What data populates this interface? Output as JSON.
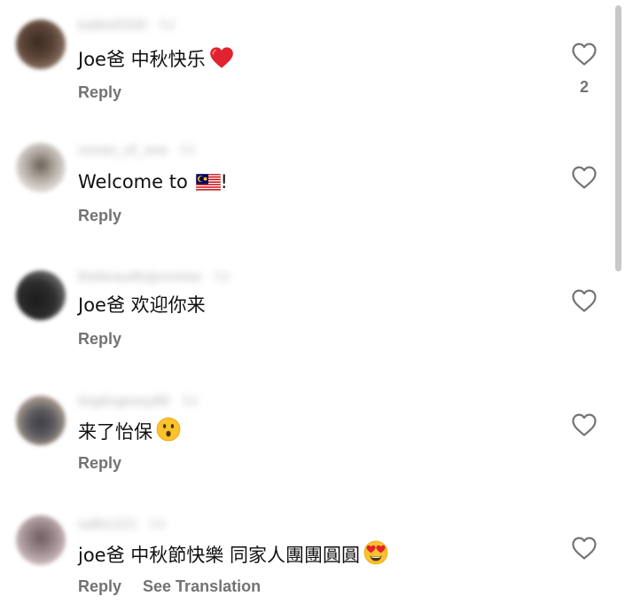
{
  "comments": [
    {
      "username": "kaiboi0330",
      "time": "5d",
      "text": "Joe爸 中秋快乐",
      "emoji_icon": "red-heart-icon",
      "like_count": "2",
      "reply_label": "Reply"
    },
    {
      "username": "ocean_of_sea",
      "time": "5d",
      "text": "Welcome to ",
      "emoji_icon": "malaysia-flag-icon",
      "text_after": "!",
      "reply_label": "Reply"
    },
    {
      "username": "thebeautifulpromise",
      "time": "5d",
      "text": "Joe爸 欢迎你来",
      "reply_label": "Reply"
    },
    {
      "username": "tingtingeasy88",
      "time": "5d",
      "text": "来了怡保",
      "emoji_icon": "astonished-face-icon",
      "reply_label": "Reply"
    },
    {
      "username": "sallii1221",
      "time": "5d",
      "text": "joe爸 中秋節快樂 同家人團團圓圓",
      "emoji_icon": "heart-eyes-face-icon",
      "reply_label": "Reply",
      "translate_label": "See Translation"
    }
  ],
  "colors": {
    "muted": "#737373",
    "text": "#111111",
    "heart": "#e0232e",
    "emoji_yellow": "#fbc22c"
  },
  "icons": {
    "like": "heart-outline-icon"
  }
}
